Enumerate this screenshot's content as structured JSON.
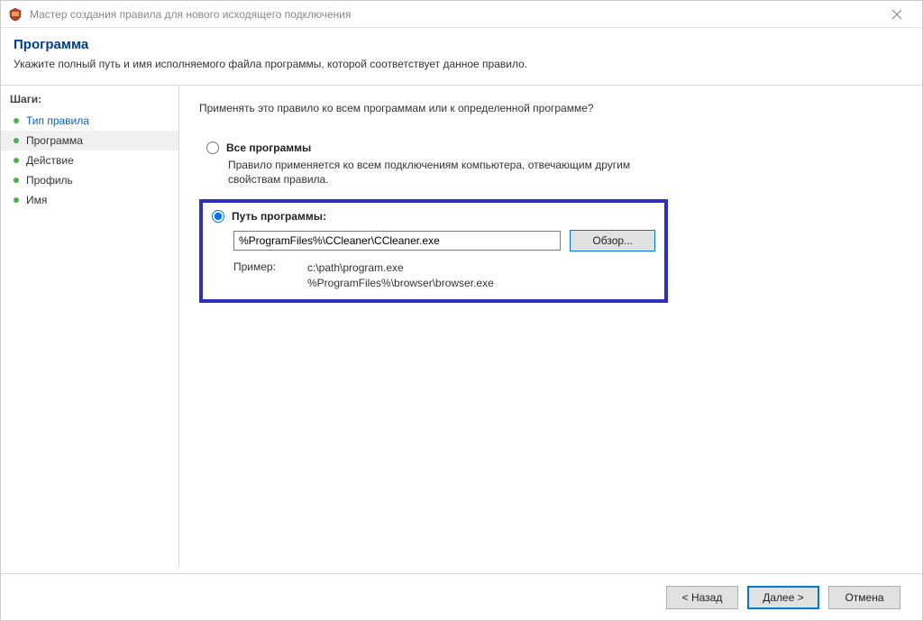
{
  "window": {
    "title": "Мастер создания правила для нового исходящего подключения"
  },
  "header": {
    "title": "Программа",
    "subtitle": "Укажите полный путь и имя исполняемого файла программы, которой соответствует данное правило."
  },
  "sidebar": {
    "heading": "Шаги:",
    "steps": [
      {
        "label": "Тип правила"
      },
      {
        "label": "Программа"
      },
      {
        "label": "Действие"
      },
      {
        "label": "Профиль"
      },
      {
        "label": "Имя"
      }
    ]
  },
  "content": {
    "prompt": "Применять это правило ко всем программам или к определенной программе?",
    "option_all": {
      "label": "Все программы",
      "desc": "Правило применяется ко всем подключениям компьютера, отвечающим другим свойствам правила."
    },
    "option_path": {
      "label": "Путь программы:",
      "value": "%ProgramFiles%\\CCleaner\\CCleaner.exe",
      "browse": "Обзор...",
      "example_label": "Пример:",
      "example_line1": "c:\\path\\program.exe",
      "example_line2": "%ProgramFiles%\\browser\\browser.exe"
    }
  },
  "footer": {
    "back": "< Назад",
    "next": "Далее >",
    "cancel": "Отмена"
  }
}
